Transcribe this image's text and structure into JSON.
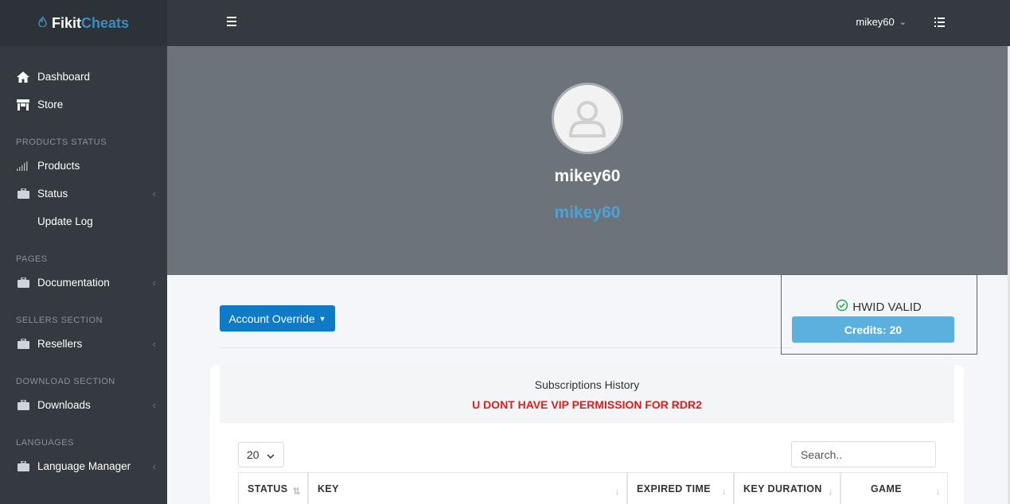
{
  "brand": {
    "part1": "Fikit",
    "part2": "Cheats"
  },
  "sidebar": {
    "items": [
      {
        "label": "Dashboard"
      },
      {
        "label": "Store"
      },
      {
        "label": "Products"
      },
      {
        "label": "Status"
      },
      {
        "label": "Update Log"
      },
      {
        "label": "Documentation"
      },
      {
        "label": "Resellers"
      },
      {
        "label": "Downloads"
      },
      {
        "label": "Language Manager"
      }
    ],
    "headers": [
      "PRODUCTS STATUS",
      "PAGES",
      "SELLERS SECTION",
      "DOWNLOAD SECTION",
      "LANGUAGES"
    ]
  },
  "topbar": {
    "username": "mikey60"
  },
  "profile": {
    "name": "mikey60",
    "username": "mikey60"
  },
  "account": {
    "override_label": "Account Override"
  },
  "hwid": {
    "status": "HWID VALID",
    "credits": "Credits: 20"
  },
  "subscriptions": {
    "title": "Subscriptions History",
    "warning": "U DONT HAVE VIP PERMISSION FOR RDR2",
    "page_length": "20",
    "search_placeholder": "Search..",
    "columns": [
      "STATUS",
      "KEY",
      "EXPIRED TIME",
      "KEY DURATION",
      "GAME"
    ]
  },
  "colors": {
    "accent": "#3c8dbc",
    "button": "#0f7bc7",
    "credits": "#5bb0de",
    "warning": "#e31b1b",
    "valid": "#28a745"
  }
}
